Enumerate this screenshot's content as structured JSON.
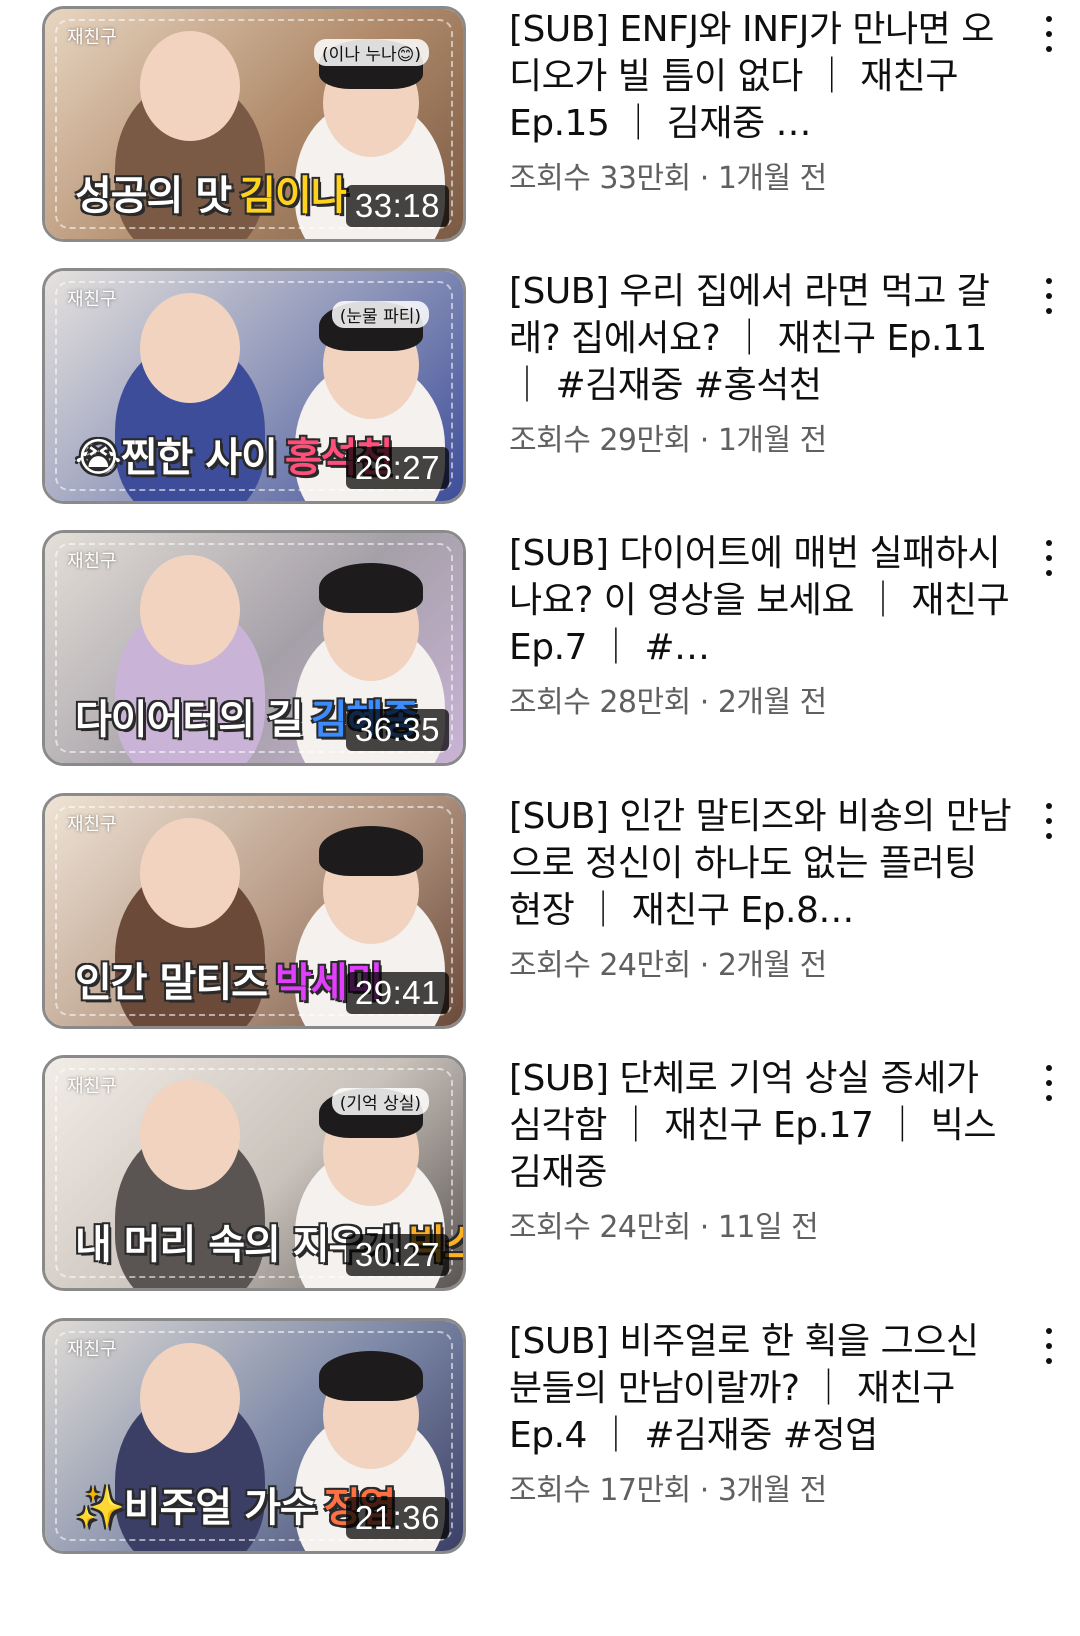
{
  "videos": [
    {
      "thumb_watermark": "재친구",
      "thumb_tag": "(이나 누나😊)",
      "thumb_banner": "성공의 맛",
      "thumb_highlight": "김이나",
      "highlight_color": "#ffd21f",
      "thumb_colors": [
        "#b08a6a",
        "#e8d6c2",
        "#7a5a44"
      ],
      "duration": "33:18",
      "title": "[SUB] ENFJ와 INFJ가 만나면 오디오가 빌 틈이 없다 ｜ 재친구 Ep.15 ｜ 김재중 …",
      "views": "조회수 33만회",
      "age": "1개월 전"
    },
    {
      "thumb_watermark": "재친구",
      "thumb_tag": "(눈물 파티)",
      "thumb_banner": "😭찐한 사이",
      "thumb_highlight": "홍석천",
      "highlight_color": "#ff4f7a",
      "thumb_colors": [
        "#8b93b8",
        "#e6e2de",
        "#3d4d9a"
      ],
      "duration": "26:27",
      "title": "[SUB] 우리 집에서 라면 먹고 갈래? 집에서요? ｜ 재친구 Ep.11 ｜ #김재중 #홍석천",
      "views": "조회수 29만회",
      "age": "1개월 전"
    },
    {
      "thumb_watermark": "재친구",
      "thumb_tag": "",
      "thumb_banner": "다이어터의 길",
      "thumb_highlight": "김혜종",
      "highlight_color": "#3b8cff",
      "thumb_colors": [
        "#a5a0a8",
        "#e4dfd8",
        "#c9b3d6"
      ],
      "duration": "36:35",
      "title": "[SUB] 다이어트에 매번 실패하시나요? 이 영상을 보세요 ｜ 재친구 Ep.7 ｜ #…",
      "views": "조회수 28만회",
      "age": "2개월 전"
    },
    {
      "thumb_watermark": "재친구",
      "thumb_tag": "",
      "thumb_banner": "인간 말티즈",
      "thumb_highlight": "박세미",
      "highlight_color": "#e040fb",
      "thumb_colors": [
        "#b79a86",
        "#efe4d6",
        "#6b4a3a"
      ],
      "duration": "29:41",
      "title": "[SUB] 인간 말티즈와 비숑의 만남으로 정신이 하나도 없는 플러팅 현장 ｜ 재친구 Ep.8…",
      "views": "조회수 24만회",
      "age": "2개월 전"
    },
    {
      "thumb_watermark": "재친구",
      "thumb_tag": "(기억 상실)",
      "thumb_banner": "내 머리 속의 지우개",
      "thumb_highlight": "빅스",
      "highlight_color": "#ffb020",
      "thumb_colors": [
        "#c9c2bb",
        "#f3ede7",
        "#5a5452"
      ],
      "duration": "30:27",
      "title": "[SUB] 단체로 기억 상실 증세가 심각함 ｜ 재친구 Ep.17 ｜ 빅스 김재중",
      "views": "조회수 24만회",
      "age": "11일 전"
    },
    {
      "thumb_watermark": "재친구",
      "thumb_tag": "",
      "thumb_banner": "✨비주얼 가수",
      "thumb_highlight": "정엽",
      "highlight_color": "#ff7043",
      "thumb_colors": [
        "#7f8aa8",
        "#e0dcd6",
        "#3b3f66"
      ],
      "duration": "21:36",
      "title": "[SUB] 비주얼로 한 획을 그으신 분들의 만남이랄까? ｜ 재친구 Ep.4 ｜ #김재중 #정엽",
      "views": "조회수 17만회",
      "age": "3개월 전"
    }
  ],
  "separator": " · ",
  "more_icon": "vertical-dots-icon"
}
